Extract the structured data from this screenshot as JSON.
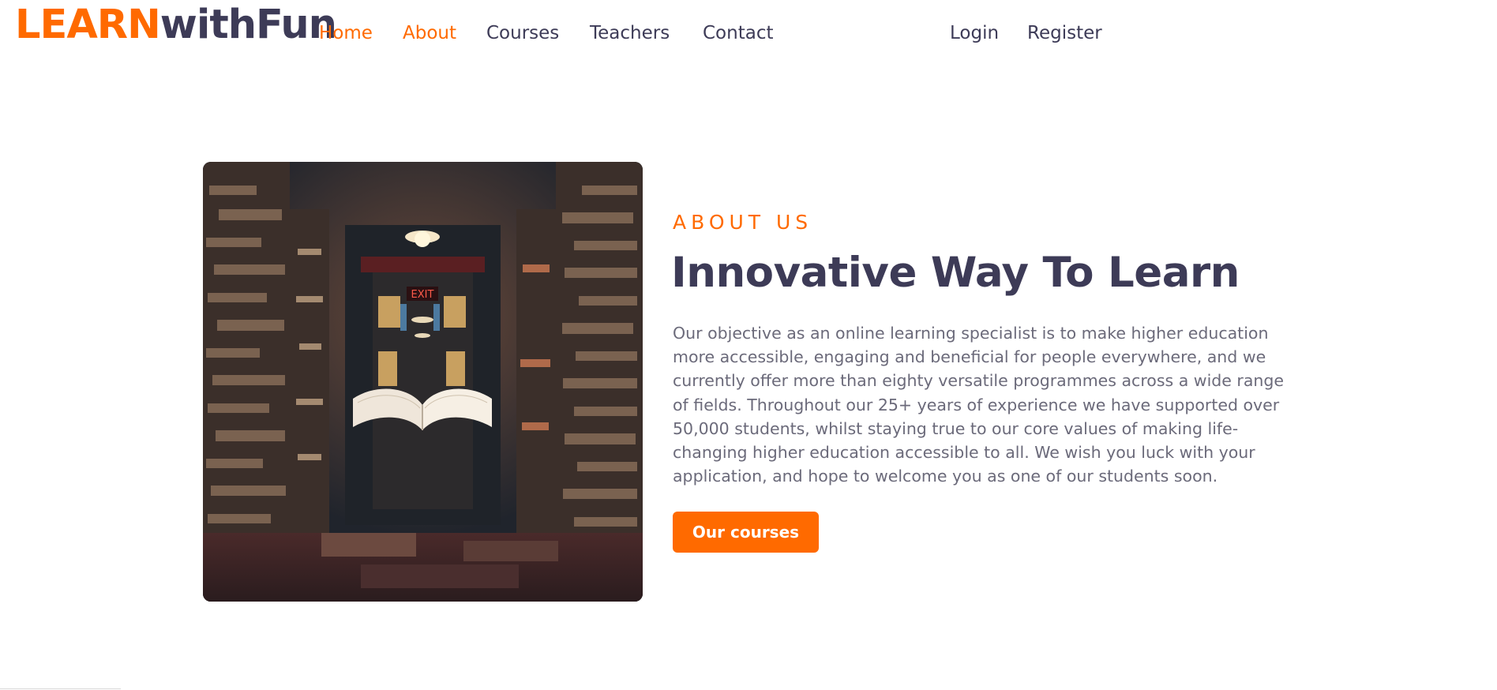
{
  "brand": {
    "part1": "LEARN",
    "part2": "withFun",
    "accent_color": "#ff6a00",
    "dark_color": "#3d3b57"
  },
  "nav": {
    "items": [
      {
        "label": "Home",
        "active": true
      },
      {
        "label": "About",
        "active": true
      },
      {
        "label": "Courses",
        "active": false
      },
      {
        "label": "Teachers",
        "active": false
      },
      {
        "label": "Contact",
        "active": false
      }
    ],
    "auth": [
      {
        "label": "Login"
      },
      {
        "label": "Register"
      }
    ]
  },
  "about": {
    "eyebrow": "ABOUT US",
    "title": "Innovative Way To Learn",
    "body": "Our objective as an online learning specialist is to make higher education more accessible, engaging and beneficial for people everywhere, and we currently offer more than eighty versatile programmes across a wide range of fields. Throughout our 25+ years of experience we have supported over 50,000 students, whilst staying true to our core values of making life-changing higher education accessible to all. We wish you luck with your application, and hope to welcome you as one of our students soon.",
    "button_label": "Our courses",
    "image_sign": "EXIT"
  }
}
